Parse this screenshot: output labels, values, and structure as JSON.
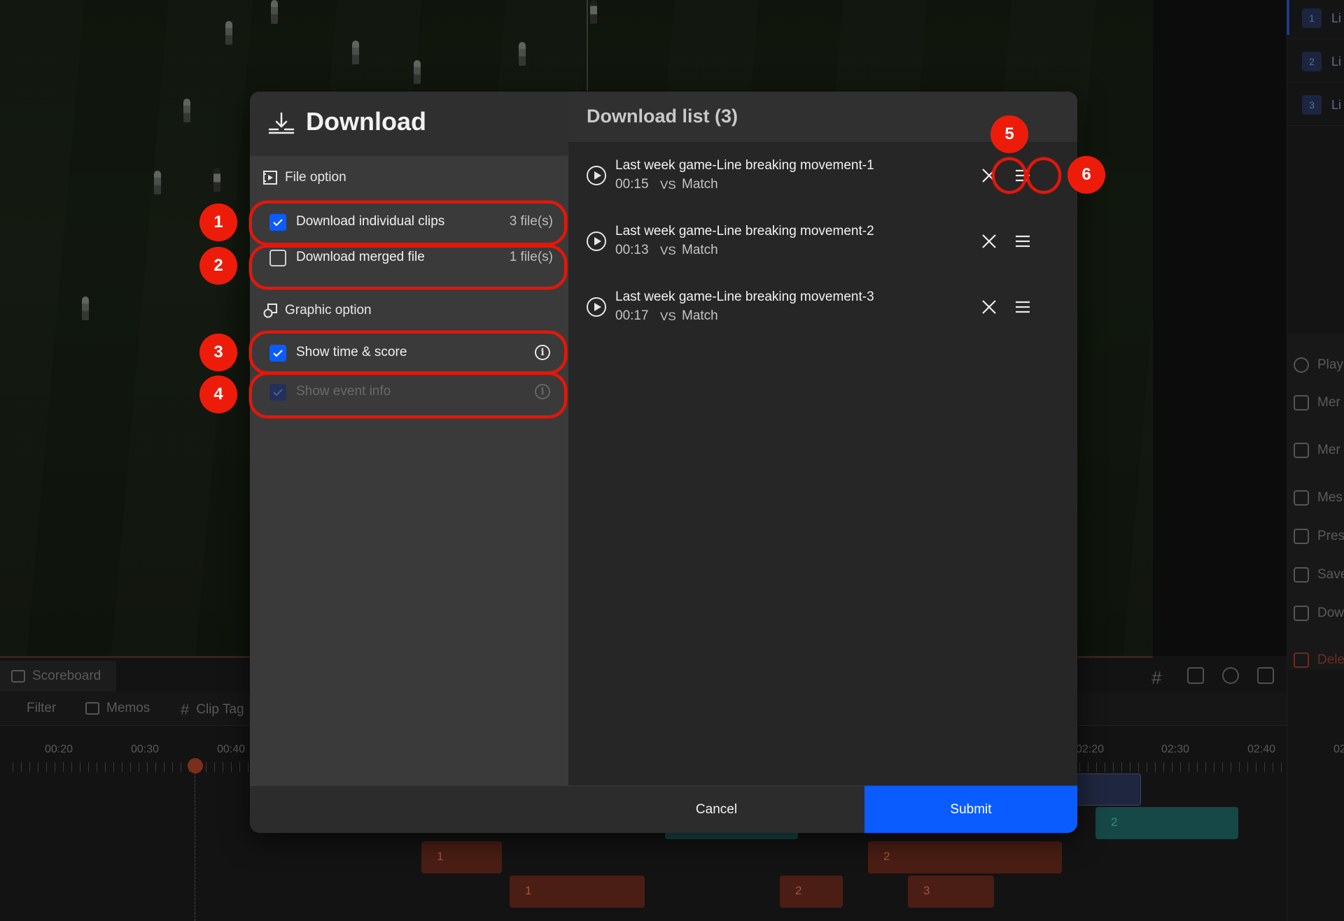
{
  "modal": {
    "title": "Download",
    "file_option": {
      "heading": "File option",
      "individual": {
        "label": "Download individual clips",
        "count": "3 file(s)",
        "checked": true
      },
      "merged": {
        "label": "Download merged file",
        "count": "1 file(s)",
        "checked": false
      }
    },
    "graphic_option": {
      "heading": "Graphic option",
      "time_score": {
        "label": "Show time & score",
        "checked": true
      },
      "event_info": {
        "label": "Show event info",
        "checked": true,
        "disabled": true
      }
    },
    "download_list": {
      "title": "Download list (3)",
      "vs_label": "VS",
      "items": [
        {
          "name": "Last week game-Line breaking movement-1",
          "duration": "00:15",
          "opponent": "Match"
        },
        {
          "name": "Last week game-Line breaking movement-2",
          "duration": "00:13",
          "opponent": "Match"
        },
        {
          "name": "Last week game-Line breaking movement-3",
          "duration": "00:17",
          "opponent": "Match"
        }
      ]
    },
    "footer": {
      "cancel": "Cancel",
      "submit": "Submit"
    }
  },
  "annotations": [
    "1",
    "2",
    "3",
    "4",
    "5",
    "6"
  ],
  "background": {
    "timeline_tabs": {
      "scoreboard": "Scoreboard",
      "filter": "Filter",
      "memos": "Memos",
      "clip_tag": "Clip Tag"
    },
    "time_labels": [
      "00:20",
      "00:30",
      "00:40",
      "02:20",
      "02:30",
      "02:40",
      "02"
    ],
    "clip_numbers": [
      "1",
      "1",
      "2",
      "2",
      "3",
      "2"
    ],
    "right_rail": {
      "list_numbers": [
        "1",
        "2",
        "3"
      ],
      "list_texts": [
        "Li",
        "Li",
        "Li"
      ],
      "menu": [
        "Play",
        "Mer",
        "Mer",
        "Mes",
        "Pres",
        "Save",
        "Dow",
        "Dele"
      ]
    }
  },
  "colors": {
    "accent": "#0a5cff",
    "annotation": "#ed1c0a",
    "panel": "#3a3a3a",
    "list_bg": "#262626"
  }
}
